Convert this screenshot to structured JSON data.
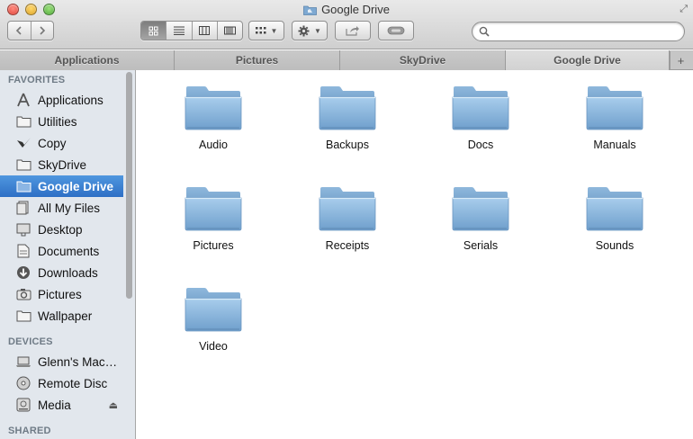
{
  "window": {
    "title": "Google Drive"
  },
  "toolbar": {
    "back_icon": "chevron-left-icon",
    "forward_icon": "chevron-right-icon",
    "view_modes": [
      "icon-view-icon",
      "list-view-icon",
      "column-view-icon",
      "coverflow-view-icon"
    ],
    "arrange_icon": "arrange-grid-icon",
    "action_icon": "gear-icon",
    "share_icon": "share-icon",
    "label_icon": "label-toggle-icon",
    "search_placeholder": ""
  },
  "tabs": [
    {
      "label": "Applications"
    },
    {
      "label": "Pictures"
    },
    {
      "label": "SkyDrive"
    },
    {
      "label": "Google Drive"
    }
  ],
  "tab_add_label": "+",
  "sidebar": {
    "favorites_title": "FAVORITES",
    "favorites": [
      {
        "label": "Applications",
        "icon": "applications-icon"
      },
      {
        "label": "Utilities",
        "icon": "folder-icon"
      },
      {
        "label": "Copy",
        "icon": "copy-icon"
      },
      {
        "label": "SkyDrive",
        "icon": "folder-icon"
      },
      {
        "label": "Google Drive",
        "icon": "folder-icon",
        "selected": true
      },
      {
        "label": "All My Files",
        "icon": "all-files-icon"
      },
      {
        "label": "Desktop",
        "icon": "desktop-icon"
      },
      {
        "label": "Documents",
        "icon": "documents-icon"
      },
      {
        "label": "Downloads",
        "icon": "downloads-icon"
      },
      {
        "label": "Pictures",
        "icon": "camera-icon"
      },
      {
        "label": "Wallpaper",
        "icon": "folder-icon"
      }
    ],
    "devices_title": "DEVICES",
    "devices": [
      {
        "label": "Glenn's Mac…",
        "icon": "laptop-icon"
      },
      {
        "label": "Remote Disc",
        "icon": "disc-icon"
      },
      {
        "label": "Media",
        "icon": "drive-icon",
        "eject": true
      }
    ],
    "shared_title": "SHARED"
  },
  "folders": [
    {
      "label": "Audio"
    },
    {
      "label": "Backups"
    },
    {
      "label": "Docs"
    },
    {
      "label": "Manuals"
    },
    {
      "label": "Pictures"
    },
    {
      "label": "Receipts"
    },
    {
      "label": "Serials"
    },
    {
      "label": "Sounds"
    },
    {
      "label": "Video"
    }
  ],
  "colors": {
    "selection": "#3a80d4",
    "folder": "#8fb8dc",
    "sidebar_bg": "#e2e7ed"
  }
}
